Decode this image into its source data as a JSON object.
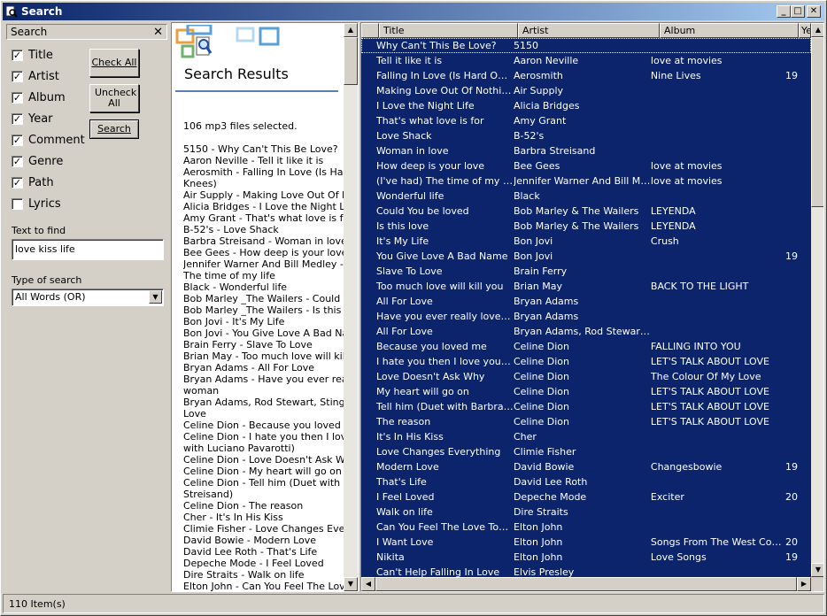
{
  "window": {
    "title": "Search"
  },
  "search_panel": {
    "header": "Search",
    "fields": [
      {
        "label": "Title",
        "checked": true
      },
      {
        "label": "Artist",
        "checked": true
      },
      {
        "label": "Album",
        "checked": true
      },
      {
        "label": "Year",
        "checked": true
      },
      {
        "label": "Comment",
        "checked": true
      },
      {
        "label": "Genre",
        "checked": true
      },
      {
        "label": "Path",
        "checked": true
      },
      {
        "label": "Lyrics",
        "checked": false
      }
    ],
    "check_all": "Check All",
    "uncheck_all": "Uncheck All",
    "search_button": "Search",
    "text_label": "Text to find",
    "text_value": "love kiss life",
    "type_label": "Type of search",
    "type_value": "All Words (OR)"
  },
  "results_panel": {
    "title": "Search Results",
    "count_text": "106 mp3 files selected.",
    "lines": [
      "5150 - Why Can't This Be Love?",
      "Aaron Neville - Tell it like it is",
      "Aerosmith - Falling In Love (Is  Hard On",
      "Knees)",
      "Air Supply - Making Love Out Of Nothing",
      "Alicia Bridges - I Love the Night Life",
      "Amy Grant - That's what love is for",
      "B-52's - Love Shack",
      "Barbra Streisand - Woman in love",
      "Bee Gees - How deep is your love",
      "Jennifer Warner And Bill Medley - (I've",
      "The time of my life",
      "Black - Wonderful life",
      "Bob Marley _The Wailers - Could You b",
      "Bob Marley _The Wailers - Is this love",
      "Bon Jovi - It's My Life",
      "Bon Jovi - You Give Love A Bad Name",
      "Brain Ferry - Slave To Love",
      "Brian May - Too much love will kill you",
      "Bryan Adams - All For Love",
      "Bryan Adams - Have you ever really lov",
      "woman",
      "Bryan Adams, Rod Stewart, Sting - All I",
      "Love",
      "Celine Dion - Because you loved me",
      "Celine Dion - I hate you then I love you",
      "with Luciano Pavarotti)",
      "Celine Dion - Love Doesn't Ask Why",
      "Celine Dion - My heart will go on",
      "Celine Dion - Tell him (Duet with Barbra",
      "Streisand)",
      "Celine Dion - The reason",
      "Cher - It's In His Kiss",
      "Climie Fisher - Love Changes Everythin",
      "David Bowie - Modern Love",
      "David Lee Roth - That's Life",
      "Depeche Mode - I Feel Loved",
      "Dire Straits - Walk on life",
      "Elton John - Can You Feel The Love T"
    ]
  },
  "track_list": {
    "columns": [
      "Title",
      "Artist",
      "Album",
      "Year"
    ],
    "rows": [
      [
        "Why Can't This Be Love?",
        "5150",
        "",
        ""
      ],
      [
        "Tell it like it is",
        "Aaron Neville",
        "love at movies",
        ""
      ],
      [
        "Falling In Love (Is  Hard On T...",
        "Aerosmith",
        "Nine Lives",
        "19"
      ],
      [
        "Making Love Out Of Nothing ...",
        "Air Supply",
        "",
        ""
      ],
      [
        "I Love the Night Life",
        "Alicia Bridges",
        "",
        ""
      ],
      [
        "That's what love is for",
        "Amy Grant",
        "",
        ""
      ],
      [
        "Love Shack",
        "B-52's",
        "",
        ""
      ],
      [
        "Woman in love",
        "Barbra Streisand",
        "",
        ""
      ],
      [
        "How deep is your love",
        "Bee Gees",
        "love at movies",
        ""
      ],
      [
        "(I've had) The time of my life",
        "Jennifer Warner And Bill Medl...",
        "love at movies",
        ""
      ],
      [
        "Wonderful life",
        "Black",
        "",
        ""
      ],
      [
        "Could You be loved",
        "Bob Marley & The Wailers",
        "LEYENDA",
        ""
      ],
      [
        "Is this love",
        "Bob Marley & The Wailers",
        "LEYENDA",
        ""
      ],
      [
        "It's My Life",
        "Bon Jovi",
        "Crush",
        ""
      ],
      [
        "You Give Love A Bad Name",
        "Bon Jovi",
        "",
        "19"
      ],
      [
        "Slave To Love",
        "Brain Ferry",
        "",
        ""
      ],
      [
        "Too much love will kill you",
        "Brian May",
        "BACK TO THE LIGHT",
        ""
      ],
      [
        "All For Love",
        "Bryan Adams",
        "",
        ""
      ],
      [
        "Have you ever really loved a ...",
        "Bryan Adams",
        "",
        ""
      ],
      [
        "All For Love",
        "Bryan Adams, Rod Stewart, ...",
        "",
        ""
      ],
      [
        "Because you loved me",
        "Celine Dion",
        "FALLING INTO YOU",
        ""
      ],
      [
        "I hate you then I love you (D...",
        "Celine Dion",
        "LET'S TALK ABOUT LOVE",
        ""
      ],
      [
        "Love Doesn't Ask Why",
        "Celine Dion",
        "The Colour Of My Love",
        ""
      ],
      [
        "My heart will go on",
        "Celine Dion",
        "LET'S TALK ABOUT LOVE",
        ""
      ],
      [
        "Tell him (Duet with Barbra Str...",
        "Celine Dion",
        "LET'S TALK ABOUT LOVE",
        ""
      ],
      [
        "The reason",
        "Celine Dion",
        "LET'S TALK ABOUT LOVE",
        ""
      ],
      [
        "It's In His Kiss",
        "Cher",
        "",
        ""
      ],
      [
        "Love Changes Everything",
        "Climie Fisher",
        "",
        ""
      ],
      [
        "Modern Love",
        "David Bowie",
        "Changesbowie",
        "19"
      ],
      [
        "That's Life",
        "David Lee Roth",
        "",
        ""
      ],
      [
        "I Feel Loved",
        "Depeche Mode",
        "Exciter",
        "20"
      ],
      [
        "Walk on life",
        "Dire Straits",
        "",
        ""
      ],
      [
        "Can You Feel The Love Toni...",
        "Elton John",
        "",
        ""
      ],
      [
        "I Want Love",
        "Elton John",
        "Songs From The West Coast",
        "20"
      ],
      [
        "Nikita",
        "Elton John",
        "Love Songs",
        "19"
      ],
      [
        "Can't Help Falling In Love",
        "Elvis Presley",
        "",
        ""
      ]
    ]
  },
  "status": {
    "text": "110 Item(s)"
  },
  "colors": {
    "selection": "#0b246b",
    "titlebar_start": "#0a246a",
    "titlebar_end": "#a6caf0"
  }
}
